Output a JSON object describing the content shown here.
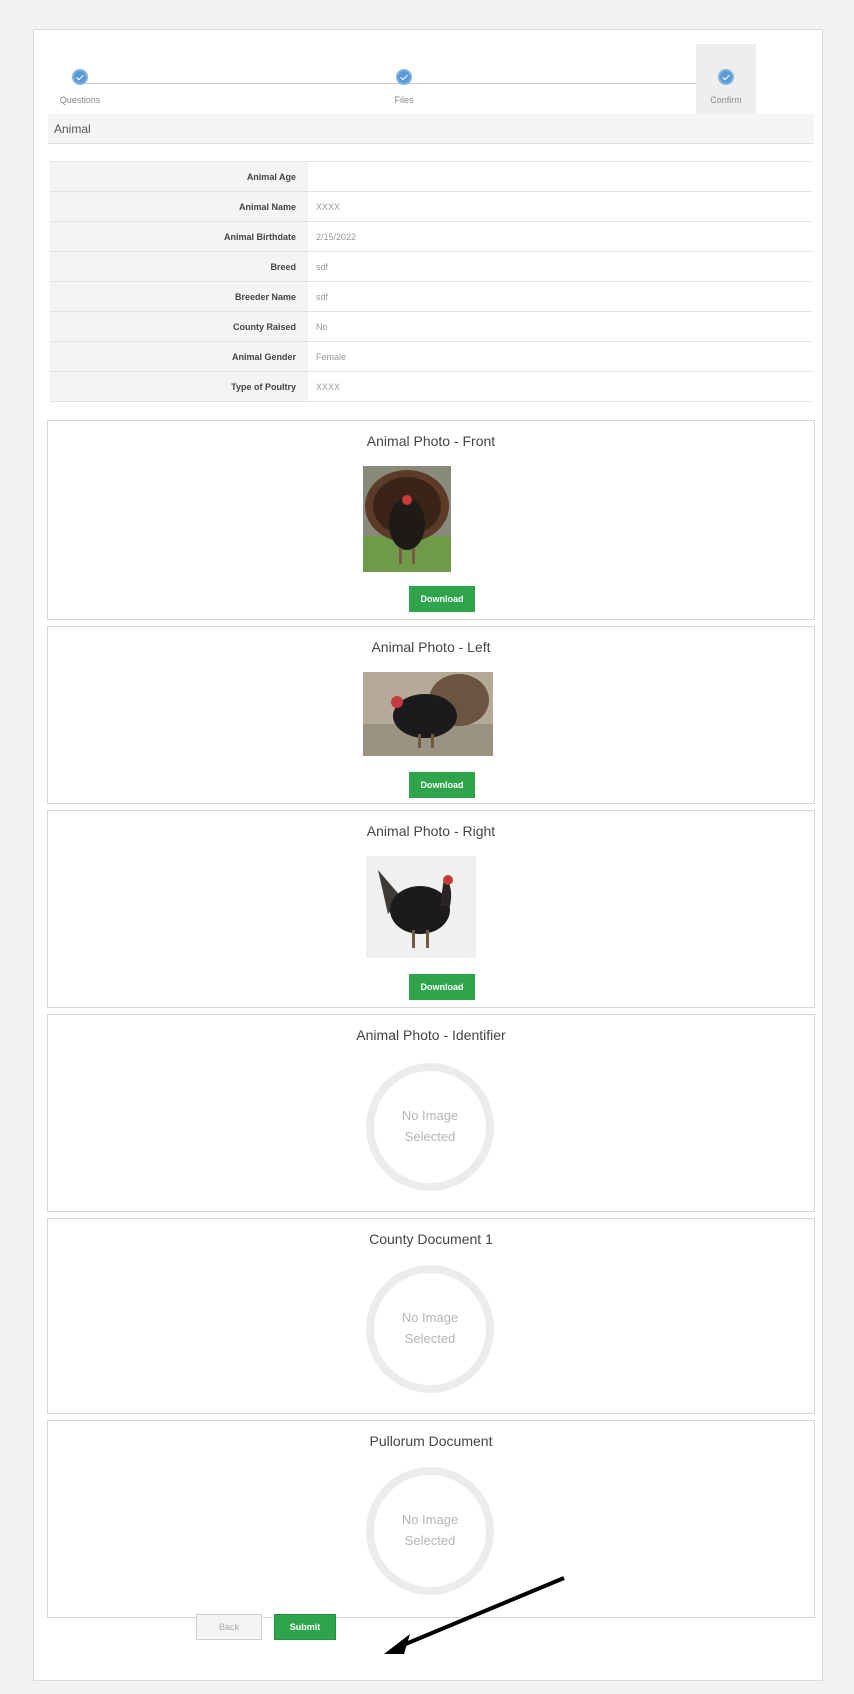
{
  "stepper": {
    "steps": [
      {
        "label": "Questions"
      },
      {
        "label": "Files"
      },
      {
        "label": "Confirm"
      }
    ]
  },
  "section": {
    "title": "Animal"
  },
  "details": [
    {
      "key": "Animal Age",
      "value": ""
    },
    {
      "key": "Animal Name",
      "value": "XXXX"
    },
    {
      "key": "Animal Birthdate",
      "value": "2/15/2022"
    },
    {
      "key": "Breed",
      "value": "sdf"
    },
    {
      "key": "Breeder Name",
      "value": "sdf"
    },
    {
      "key": "County Raised",
      "value": "No"
    },
    {
      "key": "Animal Gender",
      "value": "Female"
    },
    {
      "key": "Type of Poultry",
      "value": "XXXX"
    }
  ],
  "files": [
    {
      "title": "Animal Photo - Front",
      "button": "Download"
    },
    {
      "title": "Animal Photo - Left",
      "button": "Download"
    },
    {
      "title": "Animal Photo - Right",
      "button": "Download"
    },
    {
      "title": "Animal Photo - Identifier",
      "empty_line1": "No Image",
      "empty_line2": "Selected"
    },
    {
      "title": "County Document 1",
      "empty_line1": "No Image",
      "empty_line2": "Selected"
    },
    {
      "title": "Pullorum Document",
      "empty_line1": "No Image",
      "empty_line2": "Selected"
    }
  ],
  "footer": {
    "back_label": "Back",
    "submit_label": "Submit"
  },
  "colors": {
    "accent": "#5b9bd5",
    "success": "#2ea54a"
  }
}
